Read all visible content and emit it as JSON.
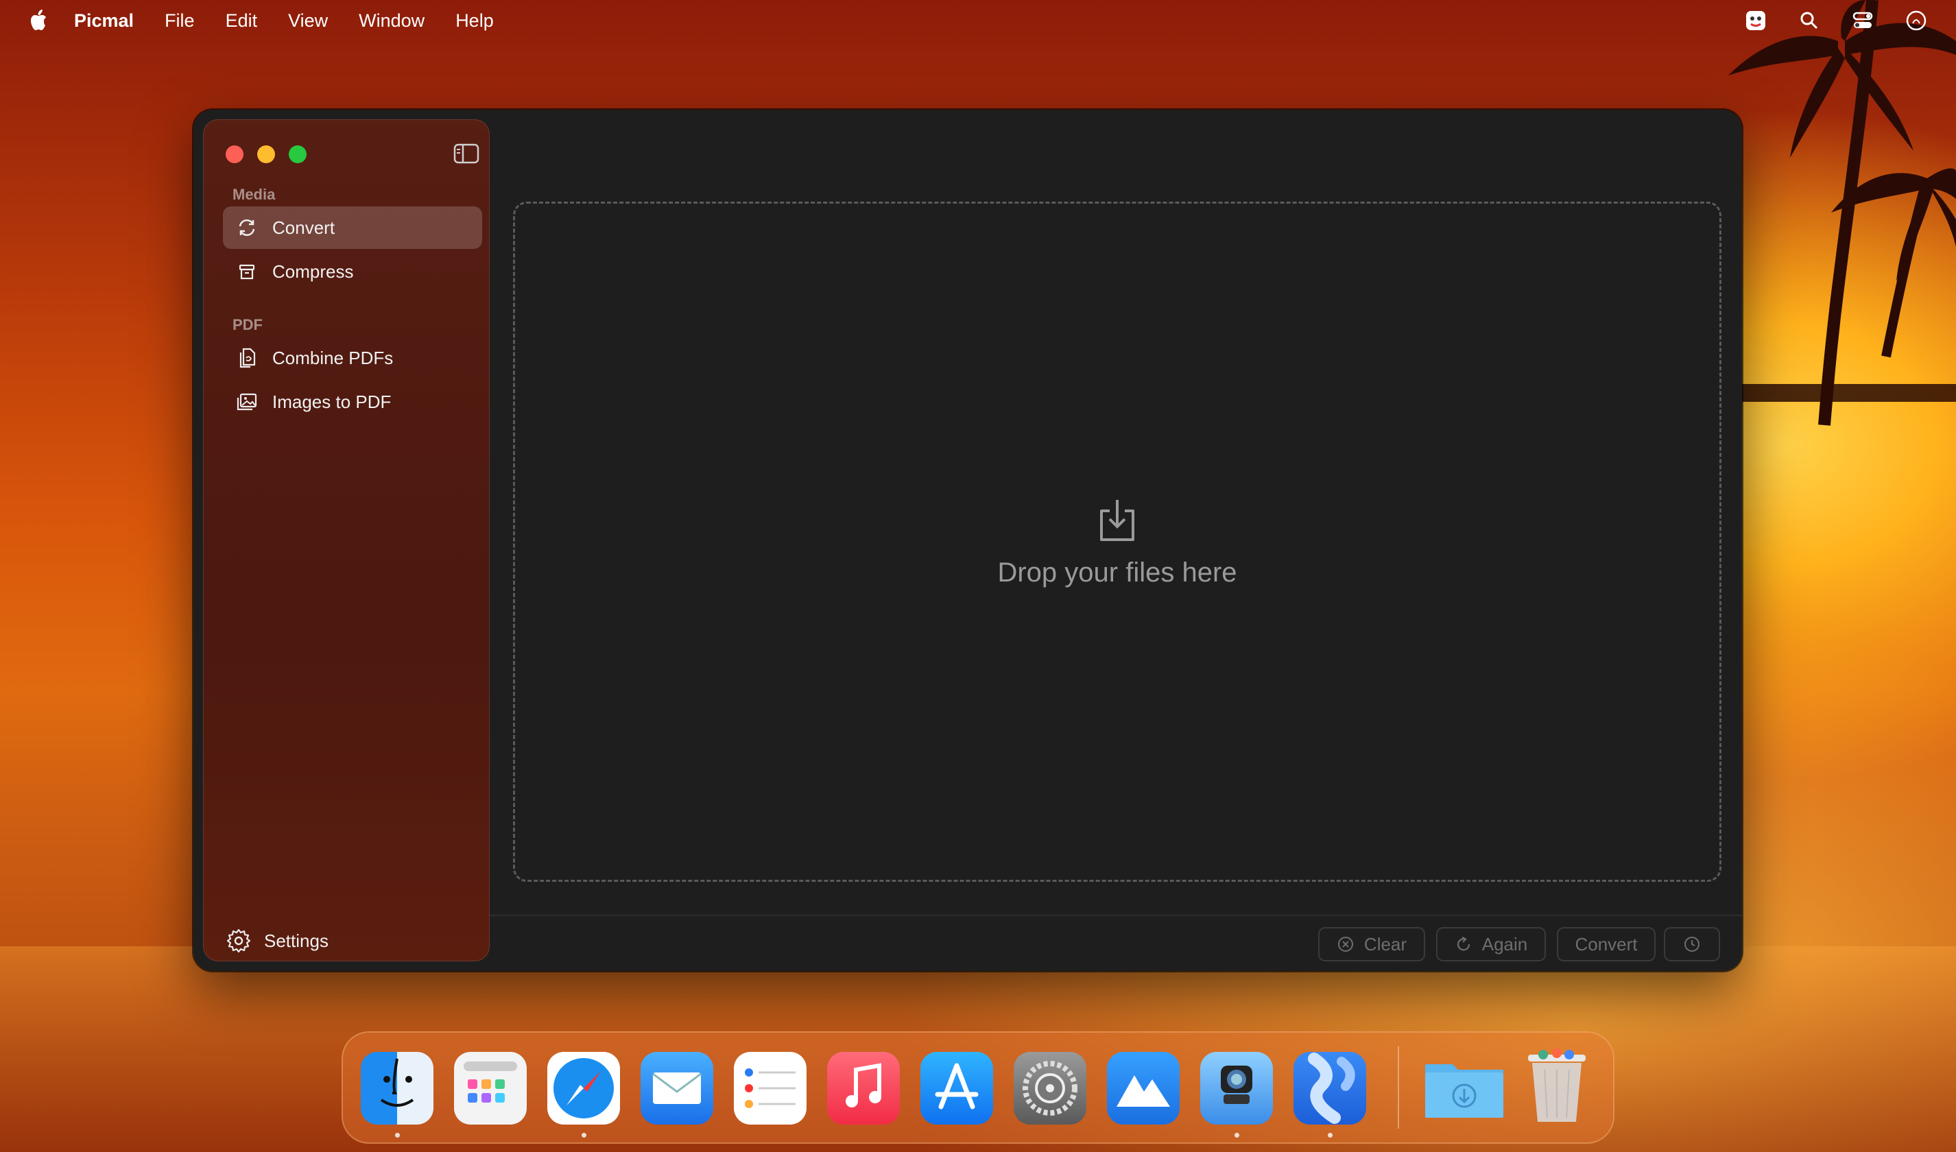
{
  "menubar": {
    "app_name": "Picmal",
    "items": [
      "File",
      "Edit",
      "View",
      "Window",
      "Help"
    ],
    "right_icons": [
      "app-status-icon",
      "spotlight-search-icon",
      "control-center-icon",
      "siri-icon"
    ]
  },
  "window": {
    "sidebar": {
      "sections": [
        {
          "label": "Media",
          "items": [
            {
              "label": "Convert",
              "icon": "convert-arrows-icon",
              "selected": true
            },
            {
              "label": "Compress",
              "icon": "archive-box-icon",
              "selected": false
            }
          ]
        },
        {
          "label": "PDF",
          "items": [
            {
              "label": "Combine PDFs",
              "icon": "combine-pdf-icon",
              "selected": false
            },
            {
              "label": "Images to PDF",
              "icon": "images-icon",
              "selected": false
            }
          ]
        }
      ],
      "settings_label": "Settings"
    },
    "dropzone": {
      "text": "Drop your files here"
    },
    "toolbar": {
      "clear_label": "Clear",
      "again_label": "Again",
      "convert_label": "Convert"
    }
  },
  "dock": {
    "apps": [
      "Finder",
      "Launchpad",
      "Safari",
      "Mail",
      "Reminders",
      "Music",
      "App Store",
      "System Settings",
      "Mountain App",
      "Preview",
      "Picmal",
      "Downloads",
      "Trash"
    ]
  },
  "colors": {
    "close": "#fe5f57",
    "minimize": "#febc2e",
    "maximize": "#28c840",
    "window_bg": "#1e1e1e"
  }
}
